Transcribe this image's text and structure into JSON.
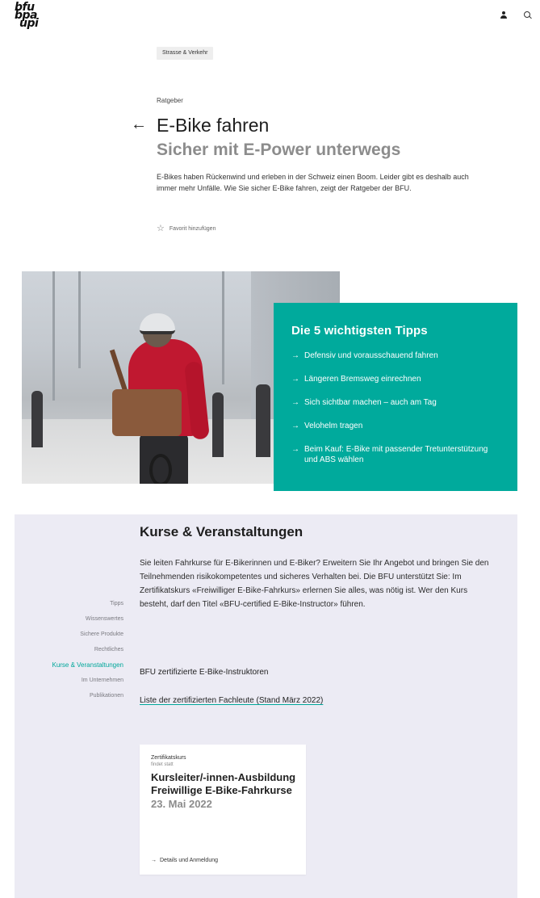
{
  "header": {
    "logo_lines": [
      "bfu",
      "bpa",
      "upi"
    ]
  },
  "intro": {
    "tag": "Strasse & Verkehr",
    "kicker": "Ratgeber",
    "title": "E-Bike fahren",
    "subtitle": "Sicher mit E-Power unterwegs",
    "lead": "E-Bikes haben Rückenwind und erleben in der Schweiz einen Boom. Leider gibt es deshalb auch immer mehr Unfälle. Wie Sie sicher E-Bike fahren, zeigt der Ratgeber der BFU.",
    "favorite_label": "Favorit hinzufügen"
  },
  "tips": {
    "title": "Die 5 wichtigsten Tipps",
    "items": [
      "Defensiv und vorausschauend fahren",
      "Längeren Bremsweg einrechnen",
      "Sich sichtbar machen – auch am Tag",
      "Velohelm tragen",
      "Beim Kauf: E-Bike mit passender Tretunterstützung und ABS wählen"
    ]
  },
  "side_nav": {
    "items": [
      "Tipps",
      "Wissenswertes",
      "Sichere Produkte",
      "Rechtliches",
      "Kurse & Veranstaltungen",
      "Im Unternehmen",
      "Publikationen"
    ],
    "active_index": 4
  },
  "courses": {
    "title": "Kurse & Veranstaltungen",
    "text": "Sie leiten Fahrkurse für E-Bikerinnen und E-Biker? Erweitern Sie Ihr Angebot und bringen Sie den Teilnehmenden risikokompetentes und sicheres Verhalten bei. Die BFU unterstützt Sie: Im Zertifikatskurs «Freiwilliger E-Bike-Fahrkurs» erlernen Sie alles, was nötig ist. Wer den Kurs besteht, darf den Titel «BFU-certified E-Bike-Instructor» führen.",
    "subheading": "BFU zertifizierte E-Bike-Instruktoren",
    "link": "Liste der zertifizierten Fachleute (Stand März 2022)",
    "card": {
      "kicker": "Zertifikatskurs",
      "status": "findet statt",
      "title": "Kursleiter/-innen-Ausbildung Freiwillige E-Bike-Fahrkurse",
      "date": "23. Mai 2022",
      "link": "Details und Anmeldung"
    }
  },
  "colors": {
    "accent": "#00aa9c",
    "section_bg": "#ecebf4"
  },
  "icons": {
    "user": "user-icon",
    "search": "search-icon",
    "back": "arrow-left-icon",
    "star": "star-icon",
    "arrow": "arrow-right-icon"
  }
}
